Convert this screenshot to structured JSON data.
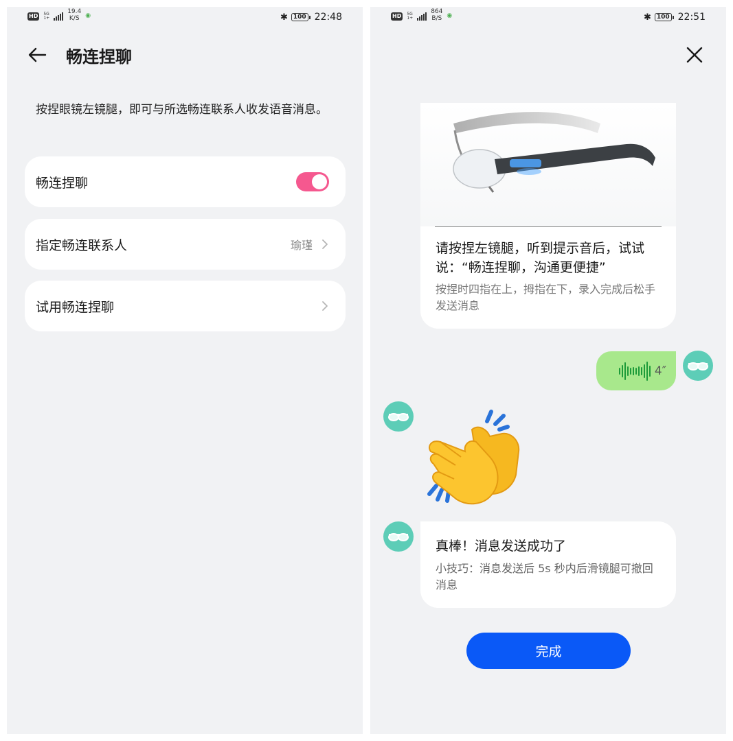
{
  "left": {
    "status": {
      "network": "5G",
      "speed_value": "19.4",
      "speed_unit": "K/S",
      "battery": "100",
      "time": "22:48"
    },
    "title": "畅连捏聊",
    "description": "按捏眼镜左镜腿，即可与所选畅连联系人收发语音消息。",
    "settings": [
      {
        "label": "畅连捏聊",
        "toggle_on": true
      },
      {
        "label": "指定畅连联系人",
        "value": "瑜瑾"
      },
      {
        "label": "试用畅连捏聊"
      }
    ]
  },
  "right": {
    "status": {
      "network": "5G",
      "speed_value": "864",
      "speed_unit": "B/S",
      "battery": "100",
      "time": "22:51"
    },
    "guide": {
      "main": "请按捏左镜腿，听到提示音后，试试说：“畅连捏聊，沟通更便捷”",
      "sub": "按捏时四指在上，拇指在下，录入完成后松手发送消息"
    },
    "voice_duration": "4″",
    "success": {
      "main": "真棒！消息发送成功了",
      "sub": "小技巧：消息发送后 5s 秒内后滑镜腿可撤回消息"
    },
    "done_label": "完成"
  },
  "colors": {
    "toggle": "#f5588f",
    "primary_button": "#0a59f7",
    "voice_bubble": "#a8e88c",
    "avatar": "#5dcdb7",
    "background": "#f1f2f4"
  },
  "icons": [
    "back-arrow-icon",
    "chevron-right-icon",
    "close-icon",
    "glasses-avatar-icon",
    "voice-wave-icon",
    "clapping-hands-emoji",
    "bluetooth-icon",
    "wifi-icon",
    "battery-icon",
    "signal-icon"
  ]
}
